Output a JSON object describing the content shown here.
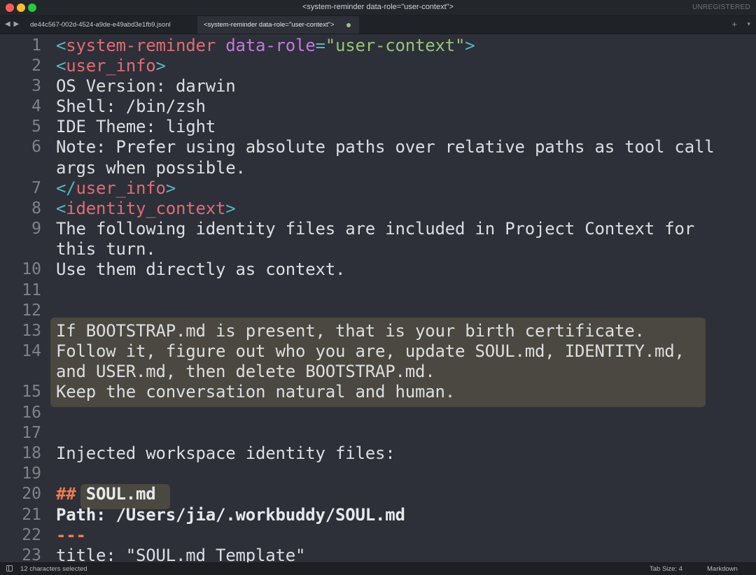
{
  "window": {
    "title": "<system-reminder data-role=\"user-context\">",
    "license_label": "UNREGISTERED"
  },
  "tabs": [
    {
      "label": "de44c567-002d-4524-a9de-e49abd3e1fb9.jsonl",
      "active": false
    },
    {
      "label": "<system-reminder data-role=\"user-context\">",
      "active": true,
      "modified": true
    }
  ],
  "tabbar": {
    "nav": "◀ ▶",
    "plus": "+",
    "chevron": "▾"
  },
  "editor": {
    "gutter": [
      "1",
      "2",
      "3",
      "4",
      "5",
      "6",
      "7",
      "8",
      "9",
      "10",
      "11",
      "12",
      "13",
      "14",
      "15",
      "16",
      "17",
      "18",
      "19",
      "20",
      "21",
      "22",
      "23"
    ],
    "lines": {
      "l1": {
        "open": "<",
        "tag": "system-reminder",
        "space": " ",
        "attr": "data-role",
        "eq": "=",
        "value": "\"user-context\"",
        "close": ">"
      },
      "l2": {
        "open": "<",
        "tag": "user_info",
        "close": ">"
      },
      "l3": "OS Version: darwin",
      "l4": "Shell: /bin/zsh",
      "l5": "IDE Theme: light",
      "l6a": "Note: Prefer using absolute paths over relative paths as tool call",
      "l6b": "args when possible.",
      "l7": {
        "open": "</",
        "tag": "user_info",
        "close": ">"
      },
      "l8": {
        "open": "<",
        "tag": "identity_context",
        "close": ">"
      },
      "l9a": "The following identity files are included in Project Context for",
      "l9b": "this turn.",
      "l10": "Use them directly as context.",
      "l13": "If BOOTSTRAP.md is present, that is your birth certificate.",
      "l14a": "Follow it, figure out who you are, update SOUL.md, IDENTITY.md,",
      "l14b": "and USER.md, then delete BOOTSTRAP.md.",
      "l15": "Keep the conversation natural and human.",
      "l18": "Injected workspace identity files:",
      "l20": {
        "hash": "##",
        "heading": "SOUL.md"
      },
      "l21": "Path: /Users/jia/.workbuddy/SOUL.md",
      "l22": "---",
      "l23": "title: \"SOUL.md Template\""
    }
  },
  "statusbar": {
    "selection": "12 characters selected",
    "tab_size": "Tab Size: 4",
    "syntax": "Markdown"
  },
  "colors": {
    "tag": "#e06c75",
    "attr": "#c678dd",
    "string": "#98c379",
    "punct": "#56b6c2",
    "hash": "#f07b52",
    "selection_bg": "#4a4840",
    "editor_bg": "#2d3038"
  }
}
